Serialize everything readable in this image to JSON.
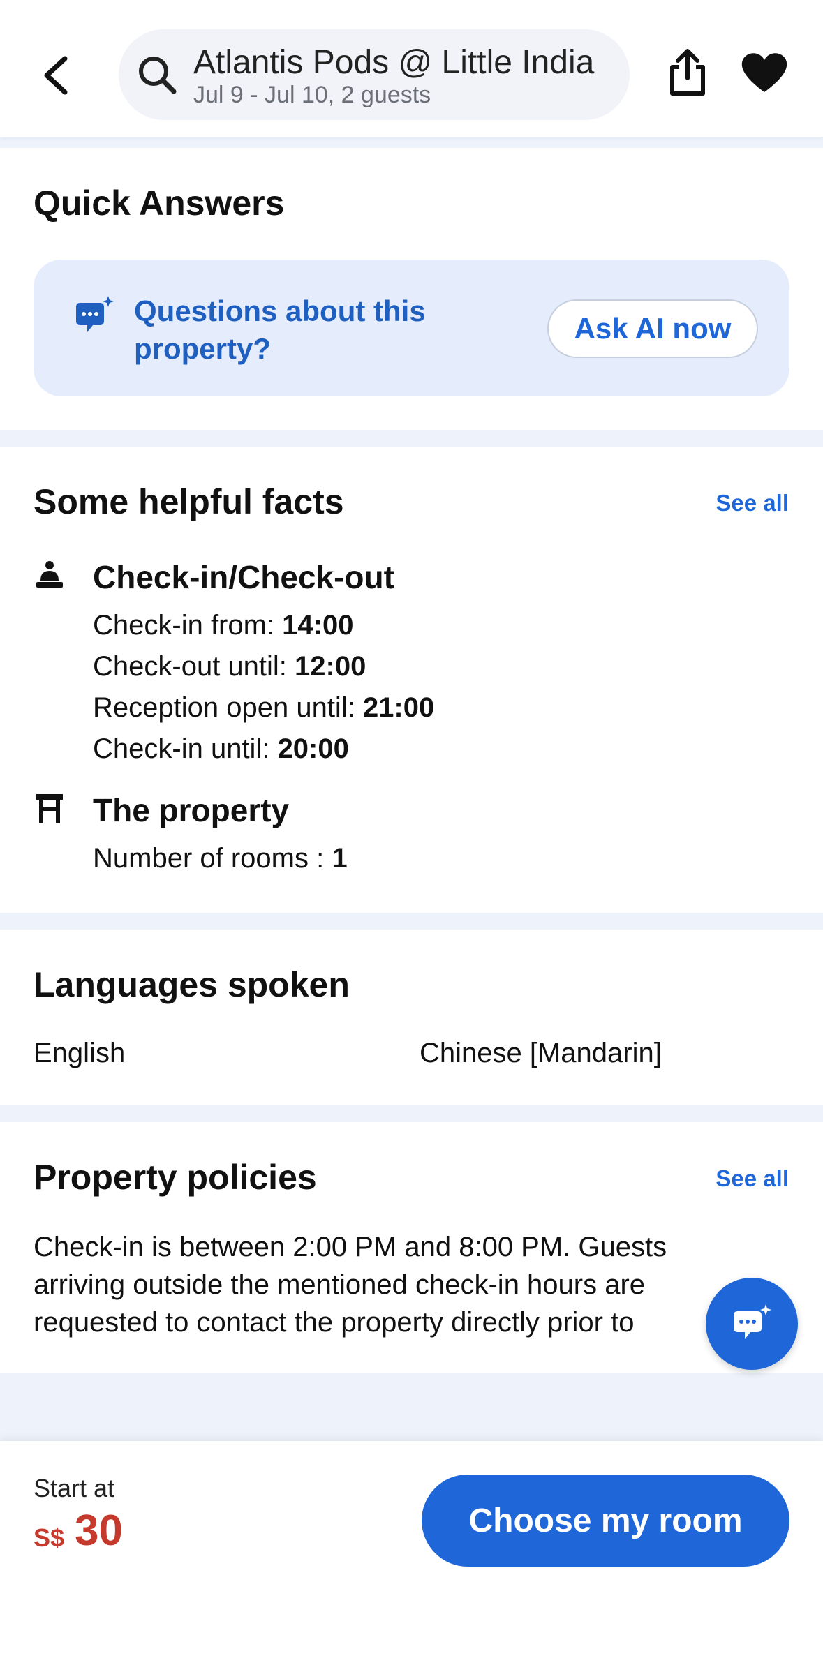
{
  "header": {
    "title": "Atlantis Pods @ Little India",
    "subtitle": "Jul 9 - Jul 10, 2 guests"
  },
  "quick_answers": {
    "heading": "Quick Answers",
    "prompt": "Questions about this property?",
    "button": "Ask AI now"
  },
  "helpful_facts": {
    "heading": "Some helpful facts",
    "see_all": "See all",
    "checkin": {
      "title": "Check-in/Check-out",
      "lines": [
        {
          "label": "Check-in from: ",
          "value": "14:00"
        },
        {
          "label": "Check-out until: ",
          "value": "12:00"
        },
        {
          "label": "Reception open until: ",
          "value": "21:00"
        },
        {
          "label": "Check-in until: ",
          "value": "20:00"
        }
      ]
    },
    "property": {
      "title": "The property",
      "label": "Number of rooms : ",
      "value": "1"
    }
  },
  "languages": {
    "heading": "Languages spoken",
    "items": [
      "English",
      "Chinese [Mandarin]"
    ]
  },
  "policies": {
    "heading": "Property policies",
    "see_all": "See all",
    "text": "Check-in is between 2:00 PM and 8:00 PM. Guests arriving outside the mentioned check-in hours are requested to contact the property directly prior to"
  },
  "footer": {
    "start_label": "Start at",
    "currency": "S$",
    "price": "30",
    "cta": "Choose my room"
  },
  "colors": {
    "accent": "#1f67d8",
    "price": "#c53a2c",
    "page_bg": "#eef2fb"
  }
}
